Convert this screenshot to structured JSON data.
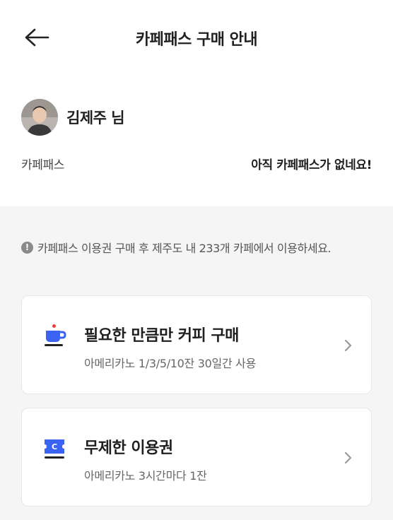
{
  "header": {
    "title": "카페패스 구매 안내"
  },
  "profile": {
    "name": "김제주 님"
  },
  "pass": {
    "label": "카페패스",
    "status": "아직 카페패스가 없네요!"
  },
  "notice": {
    "text": "카페패스 이용권 구매 후 제주도 내 233개 카페에서 이용하세요."
  },
  "options": [
    {
      "title": "필요한 만큼만 커피 구매",
      "subtitle": "아메리카노 1/3/5/10잔 30일간 사용",
      "icon": "coffee-cup-icon"
    },
    {
      "title": "무제한 이용권",
      "subtitle": "아메리카노 3시간마다 1잔",
      "icon": "ticket-icon"
    }
  ],
  "colors": {
    "accent_blue": "#3b63f2",
    "accent_red": "#e8443a",
    "background": "#f5f5f5"
  }
}
